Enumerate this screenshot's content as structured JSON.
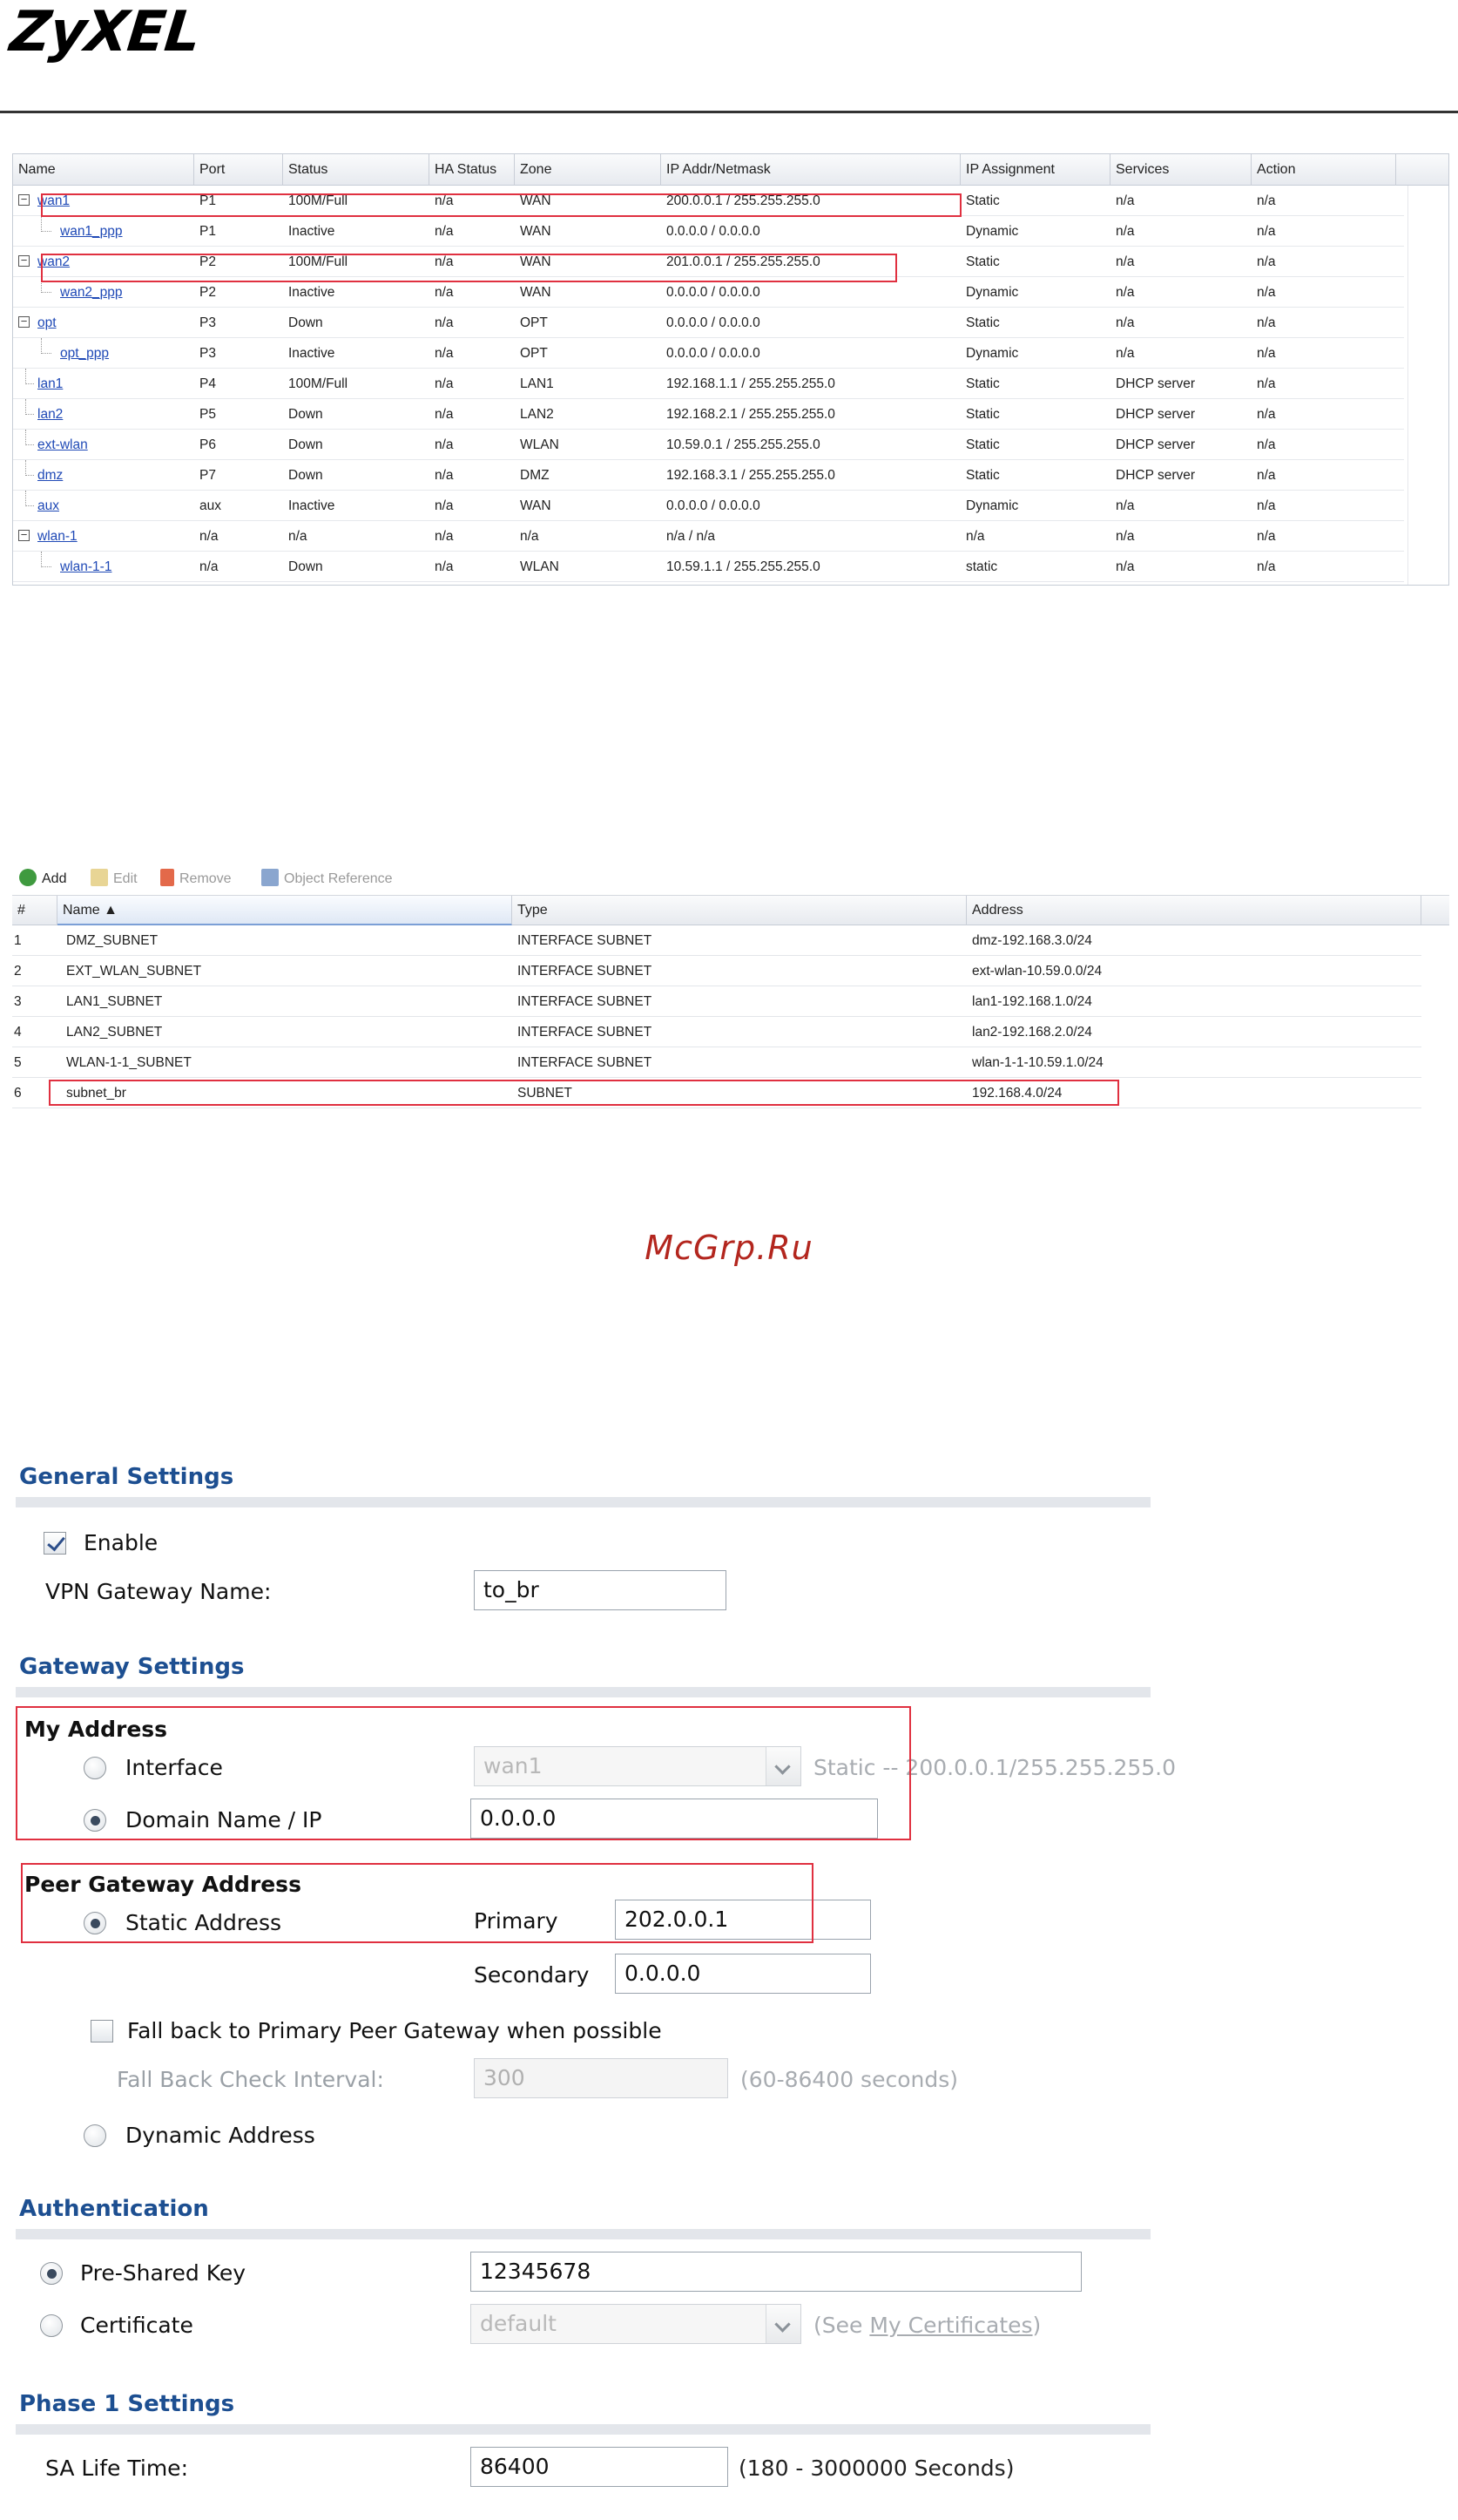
{
  "brand": "ZyXEL",
  "interfaces": {
    "headers": [
      "Name",
      "Port",
      "Status",
      "HA Status",
      "Zone",
      "IP Addr/Netmask",
      "IP Assignment",
      "Services",
      "Action"
    ],
    "rows": [
      {
        "name": "wan1",
        "port": "P1",
        "status": "100M/Full",
        "ha": "n/a",
        "zone": "WAN",
        "ip": "200.0.0.1 / 255.255.255.0",
        "assign": "Static",
        "services": "n/a",
        "action": "n/a"
      },
      {
        "name": "wan1_ppp",
        "port": "P1",
        "status": "Inactive",
        "ha": "n/a",
        "zone": "WAN",
        "ip": "0.0.0.0 / 0.0.0.0",
        "assign": "Dynamic",
        "services": "n/a",
        "action": "n/a"
      },
      {
        "name": "wan2",
        "port": "P2",
        "status": "100M/Full",
        "ha": "n/a",
        "zone": "WAN",
        "ip": "201.0.0.1 / 255.255.255.0",
        "assign": "Static",
        "services": "n/a",
        "action": "n/a"
      },
      {
        "name": "wan2_ppp",
        "port": "P2",
        "status": "Inactive",
        "ha": "n/a",
        "zone": "WAN",
        "ip": "0.0.0.0 / 0.0.0.0",
        "assign": "Dynamic",
        "services": "n/a",
        "action": "n/a"
      },
      {
        "name": "opt",
        "port": "P3",
        "status": "Down",
        "ha": "n/a",
        "zone": "OPT",
        "ip": "0.0.0.0 / 0.0.0.0",
        "assign": "Static",
        "services": "n/a",
        "action": "n/a"
      },
      {
        "name": "opt_ppp",
        "port": "P3",
        "status": "Inactive",
        "ha": "n/a",
        "zone": "OPT",
        "ip": "0.0.0.0 / 0.0.0.0",
        "assign": "Dynamic",
        "services": "n/a",
        "action": "n/a"
      },
      {
        "name": "lan1",
        "port": "P4",
        "status": "100M/Full",
        "ha": "n/a",
        "zone": "LAN1",
        "ip": "192.168.1.1 / 255.255.255.0",
        "assign": "Static",
        "services": "DHCP server",
        "action": "n/a"
      },
      {
        "name": "lan2",
        "port": "P5",
        "status": "Down",
        "ha": "n/a",
        "zone": "LAN2",
        "ip": "192.168.2.1 / 255.255.255.0",
        "assign": "Static",
        "services": "DHCP server",
        "action": "n/a"
      },
      {
        "name": "ext-wlan",
        "port": "P6",
        "status": "Down",
        "ha": "n/a",
        "zone": "WLAN",
        "ip": "10.59.0.1 / 255.255.255.0",
        "assign": "Static",
        "services": "DHCP server",
        "action": "n/a"
      },
      {
        "name": "dmz",
        "port": "P7",
        "status": "Down",
        "ha": "n/a",
        "zone": "DMZ",
        "ip": "192.168.3.1 / 255.255.255.0",
        "assign": "Static",
        "services": "DHCP server",
        "action": "n/a"
      },
      {
        "name": "aux",
        "port": "aux",
        "status": "Inactive",
        "ha": "n/a",
        "zone": "WAN",
        "ip": "0.0.0.0 / 0.0.0.0",
        "assign": "Dynamic",
        "services": "n/a",
        "action": "n/a"
      },
      {
        "name": "wlan-1",
        "port": "n/a",
        "status": "n/a",
        "ha": "n/a",
        "zone": "n/a",
        "ip": "n/a / n/a",
        "assign": "n/a",
        "services": "n/a",
        "action": "n/a"
      },
      {
        "name": "wlan-1-1",
        "port": "n/a",
        "status": "Down",
        "ha": "n/a",
        "zone": "WLAN",
        "ip": "10.59.1.1 / 255.255.255.0",
        "assign": "static",
        "services": "n/a",
        "action": "n/a"
      }
    ]
  },
  "objects": {
    "toolbar": {
      "add": "Add",
      "edit": "Edit",
      "remove": "Remove",
      "ref": "Object Reference"
    },
    "headers": {
      "num": "#",
      "name": "Name ▲",
      "type": "Type",
      "address": "Address"
    },
    "rows": [
      {
        "num": "1",
        "name": "DMZ_SUBNET",
        "type": "INTERFACE SUBNET",
        "address": "dmz-192.168.3.0/24"
      },
      {
        "num": "2",
        "name": "EXT_WLAN_SUBNET",
        "type": "INTERFACE SUBNET",
        "address": "ext-wlan-10.59.0.0/24"
      },
      {
        "num": "3",
        "name": "LAN1_SUBNET",
        "type": "INTERFACE SUBNET",
        "address": "lan1-192.168.1.0/24"
      },
      {
        "num": "4",
        "name": "LAN2_SUBNET",
        "type": "INTERFACE SUBNET",
        "address": "lan2-192.168.2.0/24"
      },
      {
        "num": "5",
        "name": "WLAN-1-1_SUBNET",
        "type": "INTERFACE SUBNET",
        "address": "wlan-1-1-10.59.1.0/24"
      },
      {
        "num": "6",
        "name": "subnet_br",
        "type": "SUBNET",
        "address": "192.168.4.0/24"
      }
    ]
  },
  "watermark": "McGrp.Ru",
  "form": {
    "general": {
      "title": "General Settings",
      "enable": "Enable",
      "name_label": "VPN Gateway Name:",
      "name_value": "to_br"
    },
    "gateway": {
      "title": "Gateway Settings",
      "my_address": "My Address",
      "interface": "Interface",
      "interface_value": "wan1",
      "interface_hint": "Static -- 200.0.0.1/255.255.255.0",
      "domain": "Domain Name / IP",
      "domain_value": "0.0.0.0",
      "peer": "Peer Gateway Address",
      "static": "Static Address",
      "primary": "Primary",
      "primary_value": "202.0.0.1",
      "secondary": "Secondary",
      "secondary_value": "0.0.0.0",
      "fallback": "Fall back to Primary Peer Gateway when possible",
      "fallback_interval": "Fall Back Check Interval:",
      "fallback_value": "300",
      "fallback_hint": "(60-86400 seconds)",
      "dynamic": "Dynamic Address"
    },
    "auth": {
      "title": "Authentication",
      "psk": "Pre-Shared Key",
      "psk_value": "12345678",
      "cert": "Certificate",
      "cert_value": "default",
      "cert_hint_pre": "(See ",
      "cert_hint_link": "My Certificates",
      "cert_hint_post": ")"
    },
    "phase1": {
      "title": "Phase 1 Settings",
      "sa_label": "SA Life Time:",
      "sa_value": "86400",
      "sa_hint": "(180 - 3000000 Seconds)"
    }
  }
}
